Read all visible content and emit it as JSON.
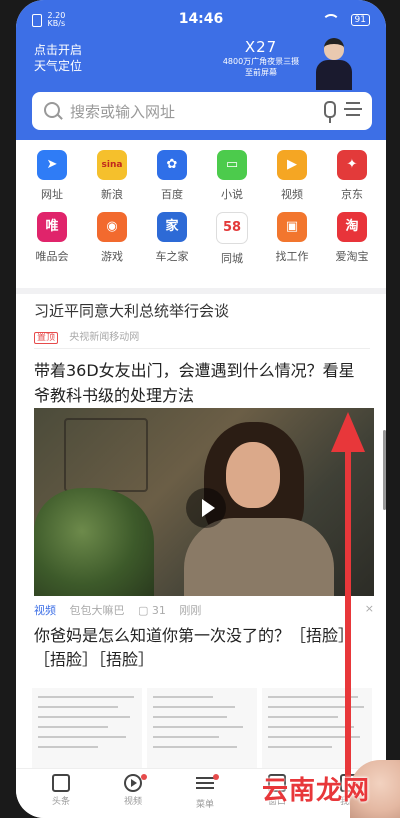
{
  "status_bar": {
    "left_top": "2.20",
    "left_bottom": "KB/s",
    "time": "14:46",
    "battery": "91"
  },
  "header": {
    "location_line1": "点击开启",
    "location_line2": "天气定位",
    "ad": {
      "brand": "X27",
      "line1": "4800万广角夜景三摄",
      "line2": "至前屏幕"
    }
  },
  "search": {
    "placeholder": "搜索或输入网址"
  },
  "shortcuts": [
    {
      "label": "网址",
      "icon": "navigation-icon",
      "color": "#2f7cf6",
      "glyph": "➤"
    },
    {
      "label": "新浪",
      "icon": "sina-icon",
      "color": "#f5c02c",
      "glyph": "sina"
    },
    {
      "label": "百度",
      "icon": "baidu-icon",
      "color": "#2f6fe8",
      "glyph": "✿"
    },
    {
      "label": "小说",
      "icon": "book-icon",
      "color": "#4ccb4c",
      "glyph": "▭"
    },
    {
      "label": "视频",
      "icon": "video-icon",
      "color": "#f5a623",
      "glyph": "▶"
    },
    {
      "label": "京东",
      "icon": "jd-icon",
      "color": "#e33a3a",
      "glyph": "✦"
    },
    {
      "label": "唯品会",
      "icon": "vip-icon",
      "color": "#e0246b",
      "glyph": "唯"
    },
    {
      "label": "游戏",
      "icon": "game-icon",
      "color": "#f26a2e",
      "glyph": "◉"
    },
    {
      "label": "车之家",
      "icon": "car-icon",
      "color": "#2d6ad6",
      "glyph": "家"
    },
    {
      "label": "同城",
      "icon": "58-icon",
      "color": "#ffffff",
      "glyph": "58"
    },
    {
      "label": "找工作",
      "icon": "job-icon",
      "color": "#f2762e",
      "glyph": "▣"
    },
    {
      "label": "爱淘宝",
      "icon": "taobao-icon",
      "color": "#e8343a",
      "glyph": "淘"
    }
  ],
  "feed": {
    "item1": {
      "title": "习近平同意大利总统举行会谈",
      "pin": "置顶",
      "source": "央视新闻移动网"
    },
    "item2": {
      "title": "带着36D女友出门，会遭遇到什么情况？看星爷教科书级的处理方法",
      "tag": "视频",
      "source": "包包大嘛巴",
      "count": "31",
      "time": "刚刚",
      "close": "×"
    },
    "item3": {
      "title": "你爸妈是怎么知道你第一次没了的？［捂脸］［捂脸］［捂脸］"
    }
  },
  "bottom_nav": [
    {
      "label": "头条",
      "icon": "news-icon"
    },
    {
      "label": "视频",
      "icon": "play-icon"
    },
    {
      "label": "菜单",
      "icon": "menu-icon"
    },
    {
      "label": "窗口",
      "icon": "windows-icon"
    },
    {
      "label": "我的",
      "icon": "profile-icon"
    }
  ],
  "watermark": "云南龙网"
}
